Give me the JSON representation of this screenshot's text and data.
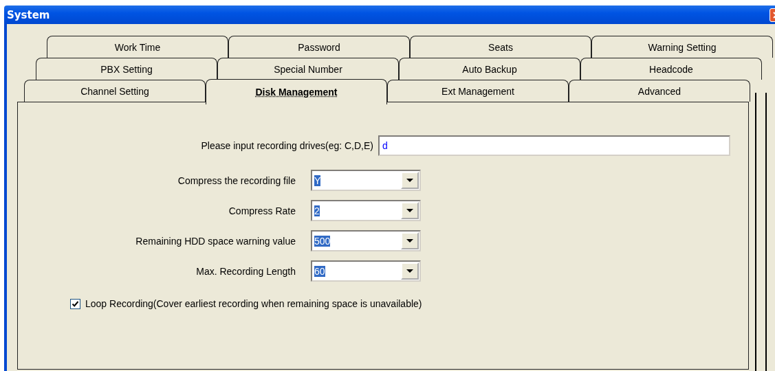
{
  "window": {
    "title": "System"
  },
  "tab_rows": [
    [
      {
        "label": "Work Time",
        "selected": false
      },
      {
        "label": "Password",
        "selected": false
      },
      {
        "label": "Seats",
        "selected": false
      },
      {
        "label": "Warning Setting",
        "selected": false
      }
    ],
    [
      {
        "label": "PBX Setting",
        "selected": false
      },
      {
        "label": "Special Number",
        "selected": false
      },
      {
        "label": "Auto Backup",
        "selected": false
      },
      {
        "label": "Headcode",
        "selected": false
      }
    ],
    [
      {
        "label": "Channel Setting",
        "selected": false
      },
      {
        "label": "Disk Management",
        "selected": true
      },
      {
        "label": "Ext Management",
        "selected": false
      },
      {
        "label": "Advanced",
        "selected": false
      }
    ]
  ],
  "drives": {
    "label": "Please input recording drives(eg: C,D,E)",
    "value": "d"
  },
  "combos": [
    {
      "label": "Compress the recording file",
      "value": "Y"
    },
    {
      "label": "Compress Rate",
      "value": "2"
    },
    {
      "label": "Remaining HDD space warning value",
      "value": "500"
    },
    {
      "label": "Max. Recording Length",
      "value": "60"
    }
  ],
  "loop_recording": {
    "label": "Loop Recording(Cover earliest recording when remaining space is unavailable)",
    "checked": true
  }
}
